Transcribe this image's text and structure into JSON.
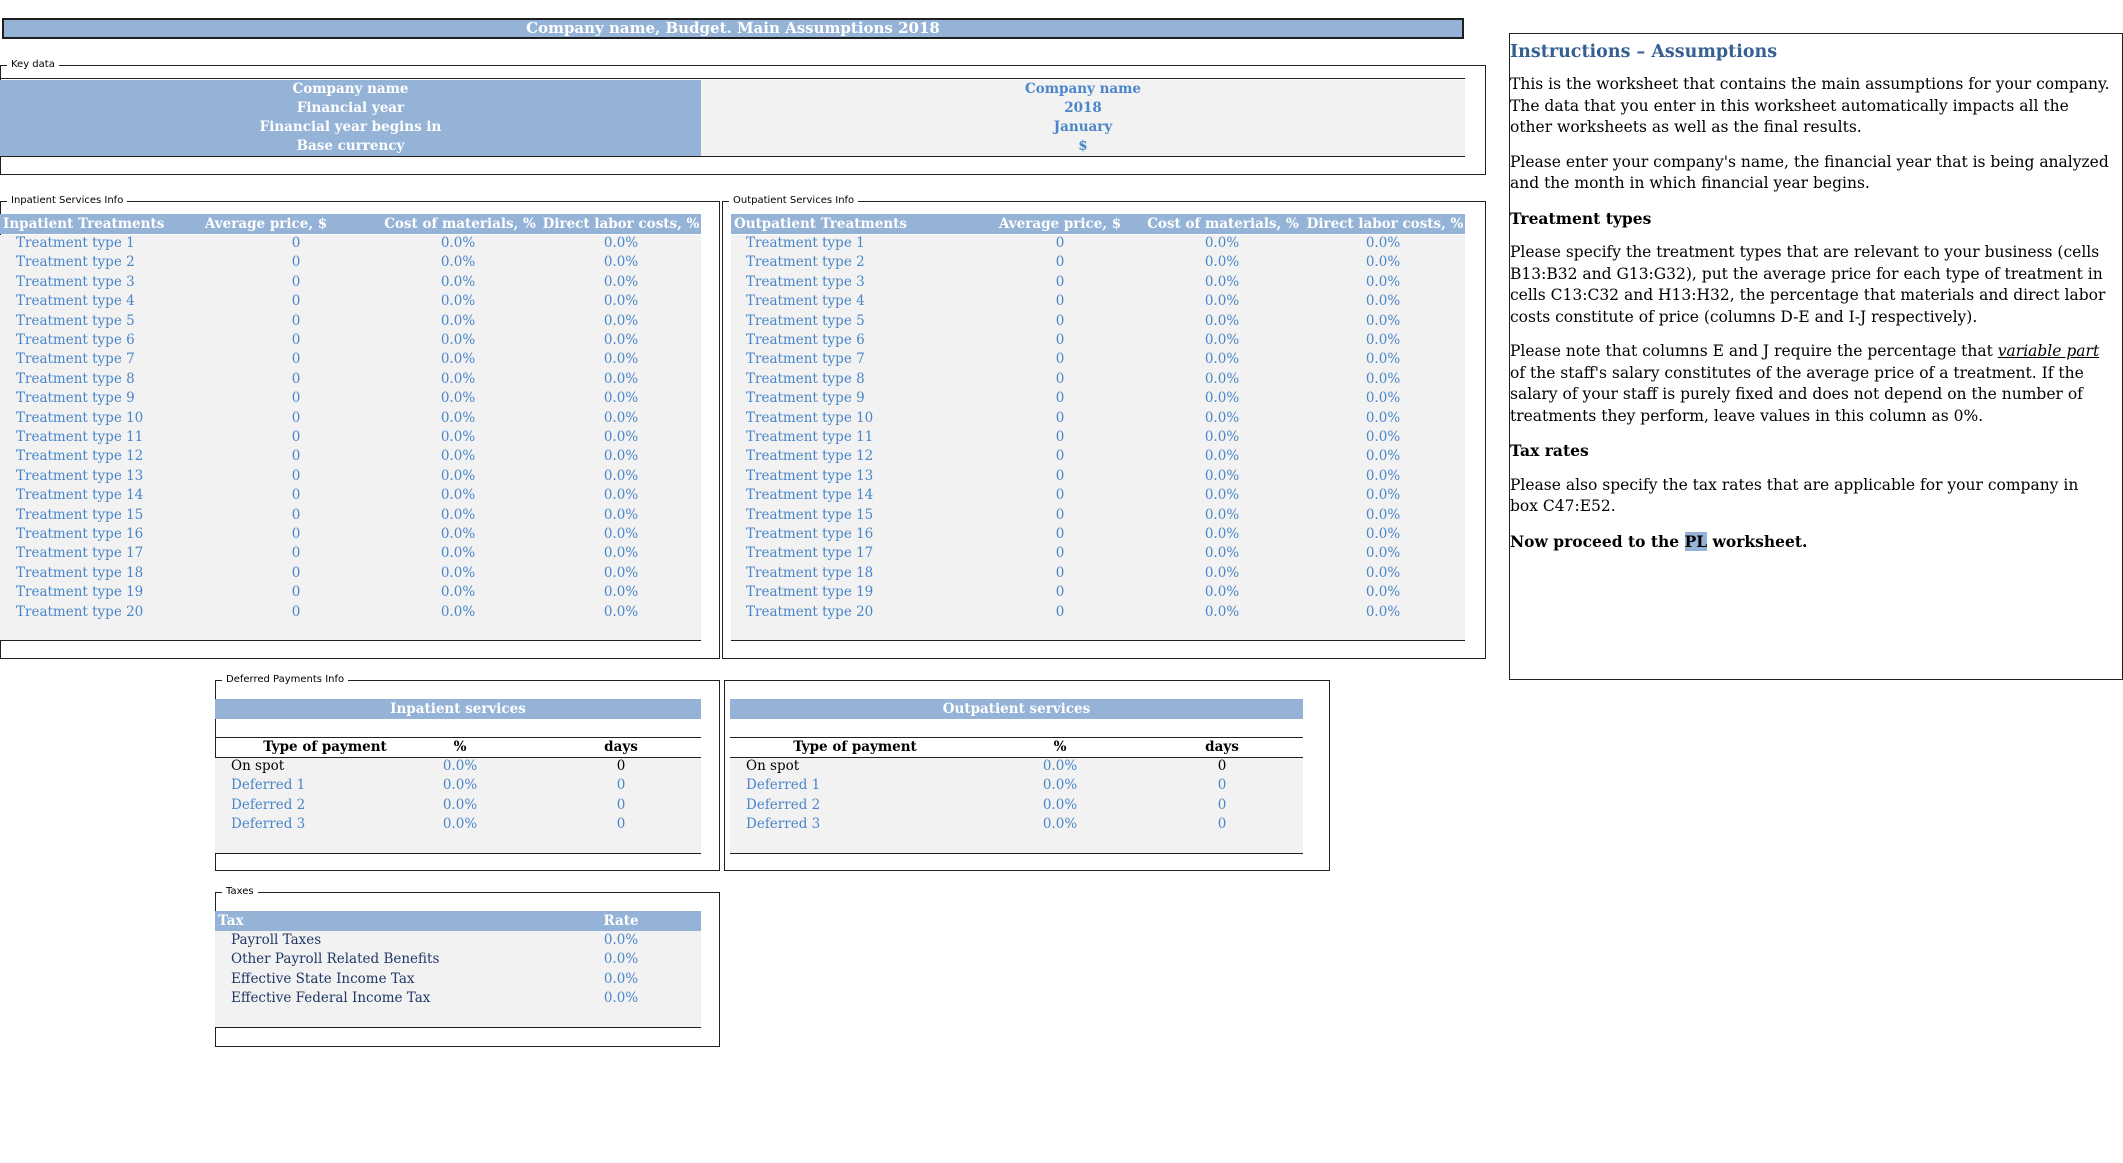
{
  "title": "Company name, Budget. Main Assumptions 2018",
  "key_data": {
    "legend": "Key data",
    "rows": [
      {
        "label": "Company name",
        "value": "Company name"
      },
      {
        "label": "Financial year",
        "value": "2018"
      },
      {
        "label": "Financial year begins in",
        "value": "January"
      },
      {
        "label": "Base currency",
        "value": "$"
      }
    ]
  },
  "inpatient": {
    "legend": "Inpatient Services Info",
    "headers": [
      "Inpatient Treatments",
      "Average price, $",
      "Cost of materials, %",
      "Direct labor costs, %"
    ]
  },
  "outpatient": {
    "legend": "Outpatient Services Info",
    "headers": [
      "Outpatient Treatments",
      "Average price, $",
      "Cost of materials, %",
      "Direct labor costs, %"
    ]
  },
  "treatments": [
    {
      "name": "Treatment type 1",
      "price": "0",
      "materials": "0.0%",
      "labor": "0.0%"
    },
    {
      "name": "Treatment type 2",
      "price": "0",
      "materials": "0.0%",
      "labor": "0.0%"
    },
    {
      "name": "Treatment type 3",
      "price": "0",
      "materials": "0.0%",
      "labor": "0.0%"
    },
    {
      "name": "Treatment type 4",
      "price": "0",
      "materials": "0.0%",
      "labor": "0.0%"
    },
    {
      "name": "Treatment type 5",
      "price": "0",
      "materials": "0.0%",
      "labor": "0.0%"
    },
    {
      "name": "Treatment type 6",
      "price": "0",
      "materials": "0.0%",
      "labor": "0.0%"
    },
    {
      "name": "Treatment type 7",
      "price": "0",
      "materials": "0.0%",
      "labor": "0.0%"
    },
    {
      "name": "Treatment type 8",
      "price": "0",
      "materials": "0.0%",
      "labor": "0.0%"
    },
    {
      "name": "Treatment type 9",
      "price": "0",
      "materials": "0.0%",
      "labor": "0.0%"
    },
    {
      "name": "Treatment type 10",
      "price": "0",
      "materials": "0.0%",
      "labor": "0.0%"
    },
    {
      "name": "Treatment type 11",
      "price": "0",
      "materials": "0.0%",
      "labor": "0.0%"
    },
    {
      "name": "Treatment type 12",
      "price": "0",
      "materials": "0.0%",
      "labor": "0.0%"
    },
    {
      "name": "Treatment type 13",
      "price": "0",
      "materials": "0.0%",
      "labor": "0.0%"
    },
    {
      "name": "Treatment type 14",
      "price": "0",
      "materials": "0.0%",
      "labor": "0.0%"
    },
    {
      "name": "Treatment type 15",
      "price": "0",
      "materials": "0.0%",
      "labor": "0.0%"
    },
    {
      "name": "Treatment type 16",
      "price": "0",
      "materials": "0.0%",
      "labor": "0.0%"
    },
    {
      "name": "Treatment type 17",
      "price": "0",
      "materials": "0.0%",
      "labor": "0.0%"
    },
    {
      "name": "Treatment type 18",
      "price": "0",
      "materials": "0.0%",
      "labor": "0.0%"
    },
    {
      "name": "Treatment type 19",
      "price": "0",
      "materials": "0.0%",
      "labor": "0.0%"
    },
    {
      "name": "Treatment type 20",
      "price": "0",
      "materials": "0.0%",
      "labor": "0.0%"
    }
  ],
  "deferred": {
    "legend": "Deferred Payments Info",
    "inpatient_title": "Inpatient services",
    "outpatient_title": "Outpatient services",
    "headers": [
      "Type of payment",
      "%",
      "days"
    ],
    "rows": [
      {
        "type": "On spot",
        "pct": "0.0%",
        "days": "0"
      },
      {
        "type": "Deferred 1",
        "pct": "0.0%",
        "days": "0"
      },
      {
        "type": "Deferred 2",
        "pct": "0.0%",
        "days": "0"
      },
      {
        "type": "Deferred 3",
        "pct": "0.0%",
        "days": "0"
      }
    ]
  },
  "taxes": {
    "legend": "Taxes",
    "headers": [
      "Tax",
      "Rate"
    ],
    "rows": [
      {
        "name": "Payroll Taxes",
        "rate": "0.0%"
      },
      {
        "name": "Other Payroll Related Benefits",
        "rate": "0.0%"
      },
      {
        "name": "Effective State Income Tax",
        "rate": "0.0%"
      },
      {
        "name": "Effective Federal Income Tax",
        "rate": "0.0%"
      }
    ]
  },
  "instructions": {
    "title": "Instructions – Assumptions",
    "p1": "This is the worksheet that contains the main assumptions for your company. The data that you enter in this worksheet automatically impacts all the other worksheets as well as the final results.",
    "p2": "Please enter your company's name, the financial year that is being analyzed and the month in which financial year begins.",
    "h_treatment": "Treatment types",
    "p3": "Please specify the treatment types that are relevant to your business (cells B13:B32 and G13:G32), put the average price for each type of treatment in cells C13:C32 and H13:H32, the percentage that materials and direct labor costs constitute of price (columns D-E and I-J respectively).",
    "p4_a": "Please note that columns E and J require the percentage that ",
    "p4_em": "variable part",
    "p4_b": " of the staff's salary constitutes of the average price of a treatment. If the salary of your staff is purely fixed and does not depend on the number of treatments they perform, leave values in this column as 0%.",
    "h_tax": "Tax rates",
    "p5": "Please also specify the tax rates that are applicable for your company in box C47:E52.",
    "p6_a": "Now proceed to the ",
    "p6_link": "PL",
    "p6_b": " worksheet."
  }
}
